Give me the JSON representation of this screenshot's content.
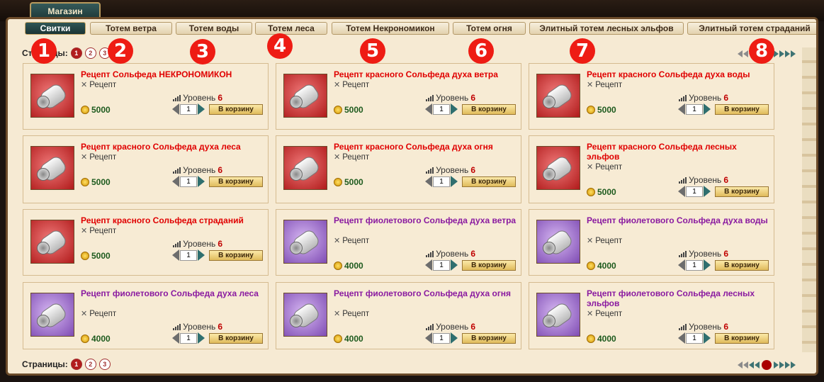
{
  "shop": {
    "title": "Магазин"
  },
  "tabs": [
    "Свитки",
    "Тотем ветра",
    "Тотем воды",
    "Тотем леса",
    "Тотем Некрономикон",
    "Тотем огня",
    "Элитный тотем лесных эльфов",
    "Элитный тотем страданий"
  ],
  "pages": {
    "label": "Страницы:",
    "numbers": [
      "1",
      "2",
      "3"
    ],
    "current": "1"
  },
  "markers": [
    "1",
    "2",
    "3",
    "4",
    "5",
    "6",
    "7",
    "8"
  ],
  "product_common": {
    "type": "Рецепт",
    "level_label": "Уровень",
    "level": "6",
    "qty": "1",
    "buy": "В корзину"
  },
  "colors": {
    "red_name": "#e00000",
    "purple_name": "#8a1aa0",
    "active_tab": "#1b3535"
  },
  "products": [
    {
      "name": "Рецепт Сольфеда НЕКРОНОМИКОН",
      "price": "5000",
      "rarity": "red"
    },
    {
      "name": "Рецепт красного Сольфеда духа ветра",
      "price": "5000",
      "rarity": "red"
    },
    {
      "name": "Рецепт красного Сольфеда духа воды",
      "price": "5000",
      "rarity": "red"
    },
    {
      "name": "Рецепт красного Сольфеда духа леса",
      "price": "5000",
      "rarity": "red"
    },
    {
      "name": "Рецепт красного Сольфеда духа огня",
      "price": "5000",
      "rarity": "red"
    },
    {
      "name": "Рецепт красного Сольфеда лесных эльфов",
      "price": "5000",
      "rarity": "red"
    },
    {
      "name": "Рецепт красного Сольфеда страданий",
      "price": "5000",
      "rarity": "red"
    },
    {
      "name": "Рецепт фиолетового Сольфеда духа ветра",
      "price": "4000",
      "rarity": "purple"
    },
    {
      "name": "Рецепт фиолетового Сольфеда духа воды",
      "price": "4000",
      "rarity": "purple"
    },
    {
      "name": "Рецепт фиолетового Сольфеда духа леса",
      "price": "4000",
      "rarity": "purple"
    },
    {
      "name": "Рецепт фиолетового Сольфеда духа огня",
      "price": "4000",
      "rarity": "purple"
    },
    {
      "name": "Рецепт фиолетового Сольфеда лесных эльфов",
      "price": "4000",
      "rarity": "purple"
    }
  ]
}
